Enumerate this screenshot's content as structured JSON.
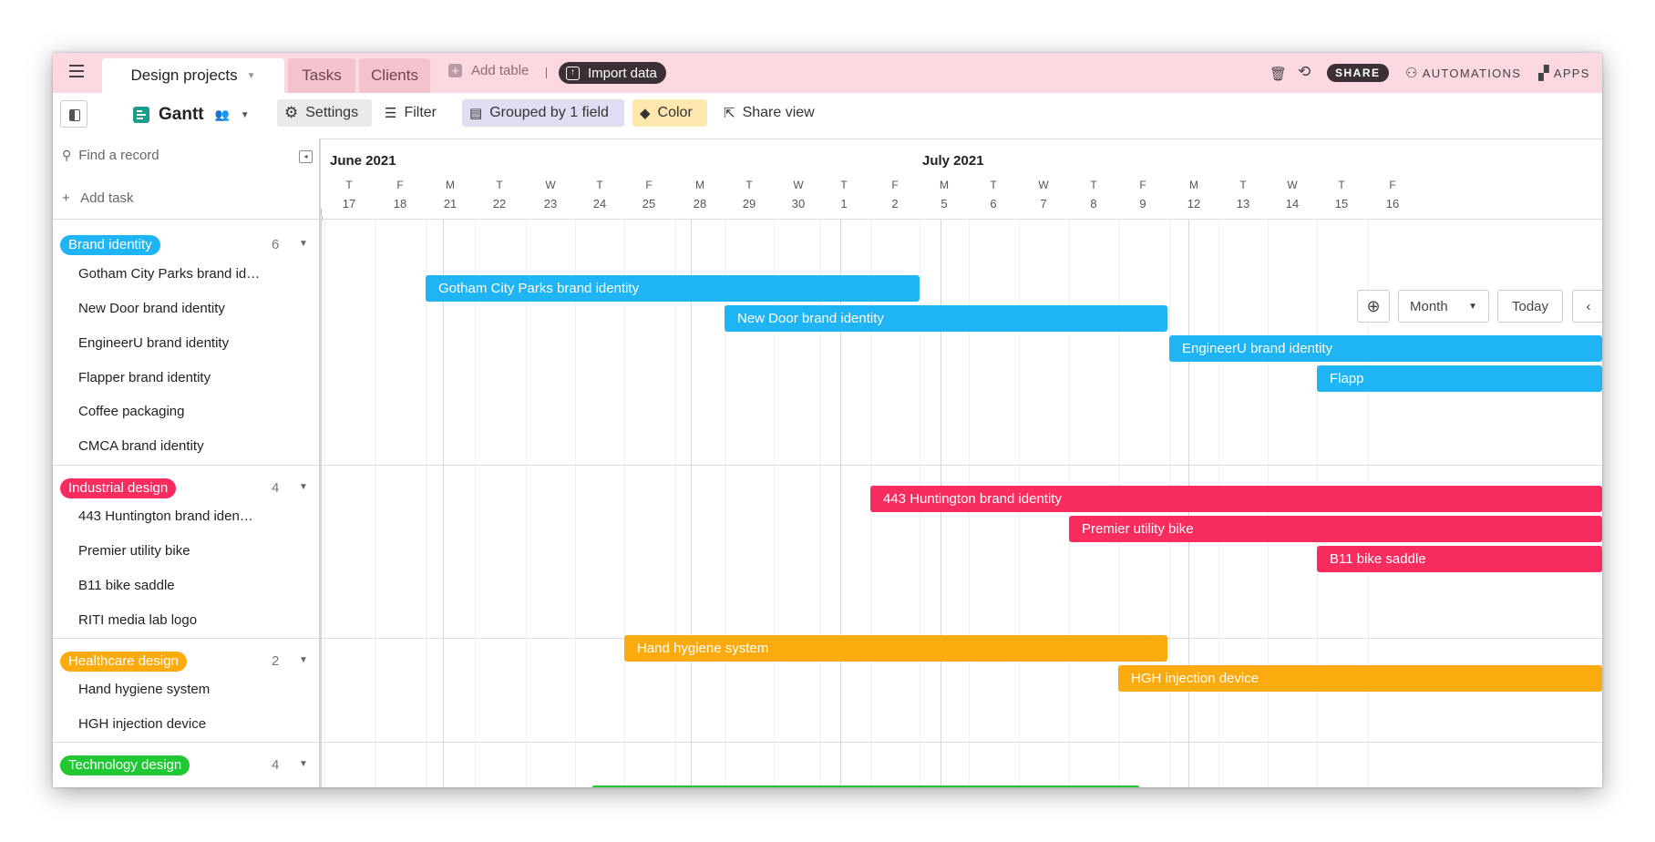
{
  "topbar": {
    "base_tab": "Design projects",
    "tabs": [
      "Tasks",
      "Clients"
    ],
    "add_table": "Add table",
    "import_data": "Import data",
    "share": "SHARE",
    "automations": "AUTOMATIONS",
    "apps": "APPS"
  },
  "toolbar": {
    "view_name": "Gantt",
    "settings": "Settings",
    "filter": "Filter",
    "grouped": "Grouped by 1 field",
    "color": "Color",
    "share_view": "Share view"
  },
  "sidebar": {
    "find_placeholder": "Find a record",
    "add_task": "Add task"
  },
  "timeline": {
    "months": [
      {
        "label": "June 2021"
      },
      {
        "label": "July 2021"
      }
    ],
    "days": [
      {
        "letter": "T",
        "num": "17"
      },
      {
        "letter": "F",
        "num": "18"
      },
      {
        "letter": "M",
        "num": "21"
      },
      {
        "letter": "T",
        "num": "22"
      },
      {
        "letter": "W",
        "num": "23"
      },
      {
        "letter": "T",
        "num": "24"
      },
      {
        "letter": "F",
        "num": "25"
      },
      {
        "letter": "M",
        "num": "28"
      },
      {
        "letter": "T",
        "num": "29"
      },
      {
        "letter": "W",
        "num": "30"
      },
      {
        "letter": "T",
        "num": "1"
      },
      {
        "letter": "F",
        "num": "2"
      },
      {
        "letter": "M",
        "num": "5"
      },
      {
        "letter": "T",
        "num": "6"
      },
      {
        "letter": "W",
        "num": "7"
      },
      {
        "letter": "T",
        "num": "8"
      },
      {
        "letter": "F",
        "num": "9"
      },
      {
        "letter": "M",
        "num": "12"
      },
      {
        "letter": "T",
        "num": "13"
      },
      {
        "letter": "W",
        "num": "14"
      },
      {
        "letter": "T",
        "num": "15"
      },
      {
        "letter": "F",
        "num": "16"
      }
    ],
    "controls": {
      "scale": "Month",
      "today": "Today"
    }
  },
  "groups": [
    {
      "name": "Brand identity",
      "count": "6",
      "color": "#1fb4f4",
      "records": [
        {
          "label": "Gotham City Parks brand id…",
          "bar": "Gotham City Parks brand identity",
          "start": "2021-06-21",
          "end": "2021-07-02"
        },
        {
          "label": "New Door brand identity",
          "bar": "New Door brand identity",
          "start": "2021-06-29",
          "end": "2021-07-09"
        },
        {
          "label": "EngineerU brand identity",
          "bar": "EngineerU brand identity",
          "start": "2021-07-12",
          "end": null
        },
        {
          "label": "Flapper brand identity",
          "bar": "Flapp",
          "start": "2021-07-15",
          "end": null
        },
        {
          "label": "Coffee packaging",
          "bar": null
        },
        {
          "label": "CMCA brand identity",
          "bar": null
        }
      ]
    },
    {
      "name": "Industrial design",
      "count": "4",
      "color": "#f82c5f",
      "records": [
        {
          "label": "443 Huntington brand iden…",
          "bar": "443 Huntington brand identity",
          "start": "2021-07-02",
          "end": null
        },
        {
          "label": "Premier utility bike",
          "bar": "Premier utility bike",
          "start": "2021-07-08",
          "end": null
        },
        {
          "label": "B11 bike saddle",
          "bar": "B11 bike saddle",
          "start": "2021-07-15",
          "end": null
        },
        {
          "label": "RITI media lab logo",
          "bar": null
        }
      ]
    },
    {
      "name": "Healthcare design",
      "count": "2",
      "color": "#fcab0f",
      "records": [
        {
          "label": "Hand hygiene system",
          "bar": "Hand hygiene system",
          "start": "2021-06-25",
          "end": "2021-07-09"
        },
        {
          "label": "HGH injection device",
          "bar": "HGH injection device",
          "start": "2021-07-09",
          "end": null
        }
      ]
    },
    {
      "name": "Technology design",
      "count": "4",
      "color": "#20c933",
      "records": []
    }
  ]
}
